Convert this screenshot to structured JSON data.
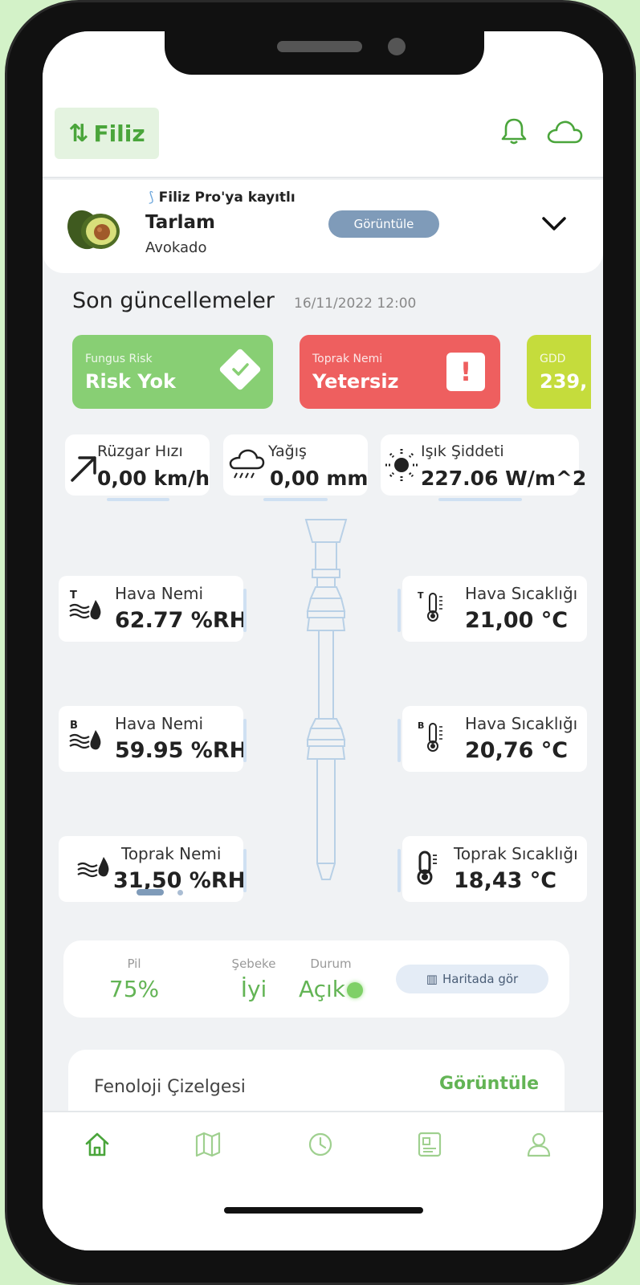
{
  "header": {
    "brand": "Filiz"
  },
  "field": {
    "pro_tag": "Filiz Pro'ya kayıtlı",
    "name": "Tarlam",
    "crop": "Avokado",
    "view_button": "Görüntüle"
  },
  "updates": {
    "title": "Son güncellemeler",
    "timestamp": "16/11/2022 12:00",
    "cards": [
      {
        "label": "Fungus Risk",
        "value": "Risk Yok",
        "color": "#88cf74",
        "icon": "check-icon"
      },
      {
        "label": "Toprak Nemi",
        "value": "Yetersiz",
        "color": "#ee5f5f",
        "icon": "alert-icon"
      },
      {
        "label": "GDD",
        "value": "239,",
        "color": "#c5dc3c"
      }
    ]
  },
  "weather": [
    {
      "label": "Rüzgar Hızı",
      "value": "0,00 km/h",
      "icon": "wind-arrow-icon"
    },
    {
      "label": "Yağış",
      "value": "0,00 mm",
      "icon": "rain-cloud-icon"
    },
    {
      "label": "Işık Şiddeti",
      "value": "227.06 W/m^2",
      "icon": "sun-icon"
    }
  ],
  "sensors": {
    "left": [
      {
        "label": "Hava Nemi",
        "value": "62.77 %RH",
        "badge": "T",
        "icon": "humidity-icon"
      },
      {
        "label": "Hava Nemi",
        "value": "59.95 %RH",
        "badge": "B",
        "icon": "humidity-icon"
      },
      {
        "label": "Toprak Nemi",
        "value": "31,50 %RH",
        "badge": "",
        "icon": "soil-humidity-icon"
      }
    ],
    "right": [
      {
        "label": "Hava Sıcaklığı",
        "value": "21,00 °C",
        "badge": "T",
        "icon": "thermometer-icon"
      },
      {
        "label": "Hava Sıcaklığı",
        "value": "20,76 °C",
        "badge": "B",
        "icon": "thermometer-icon"
      },
      {
        "label": "Toprak Sıcaklığı",
        "value": "18,43 °C",
        "badge": "",
        "icon": "thermometer-icon"
      }
    ]
  },
  "device": {
    "battery_label": "Pil",
    "battery_value": "75%",
    "network_label": "Şebeke",
    "network_value": "İyi",
    "status_label": "Durum",
    "status_value": "Açık",
    "map_button": "Haritada gör"
  },
  "phenology": {
    "title": "Fenoloji Çizelgesi",
    "action": "Görüntüle"
  },
  "tabs": [
    "home-icon",
    "map-icon",
    "history-icon",
    "report-icon",
    "profile-icon"
  ],
  "colors": {
    "brand_green": "#4aa53b",
    "background": "#d3f2c8"
  }
}
